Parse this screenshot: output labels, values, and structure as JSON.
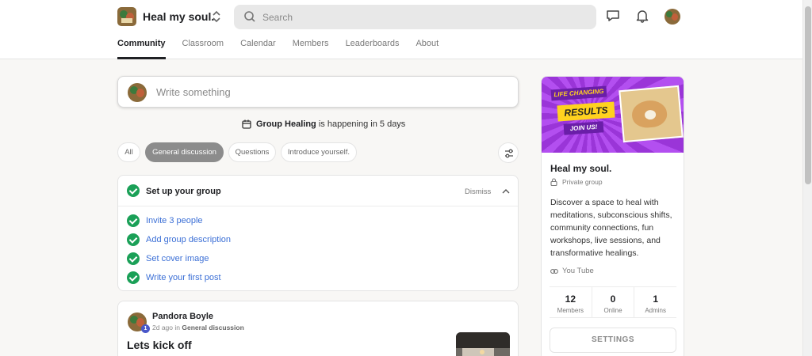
{
  "header": {
    "group_name": "Heal my soul.",
    "search_placeholder": "Search"
  },
  "tabs": [
    {
      "label": "Community",
      "active": true
    },
    {
      "label": "Classroom",
      "active": false
    },
    {
      "label": "Calendar",
      "active": false
    },
    {
      "label": "Members",
      "active": false
    },
    {
      "label": "Leaderboards",
      "active": false
    },
    {
      "label": "About",
      "active": false
    }
  ],
  "composer": {
    "placeholder": "Write something"
  },
  "event": {
    "name": "Group Healing",
    "suffix": "is happening in 5 days"
  },
  "filters": [
    "All",
    "General discussion",
    "Questions",
    "Introduce yourself."
  ],
  "setup": {
    "title": "Set up your group",
    "dismiss": "Dismiss",
    "tasks": [
      "Invite 3 people",
      "Add group description",
      "Set cover image",
      "Write your first post"
    ]
  },
  "post": {
    "author": "Pandora Boyle",
    "level": "1",
    "time": "2d ago in",
    "category": "General discussion",
    "title": "Lets kick off"
  },
  "sidebar": {
    "banner": {
      "line1": "LIFE CHANGING",
      "line2": "RESULTS",
      "line3": "JOIN US!"
    },
    "name": "Heal my soul.",
    "privacy": "Private group",
    "description": "Discover a space to heal with meditations, subconscious shifts, community connections, fun workshops, live sessions, and transformative healings.",
    "link": "You Tube",
    "stats": [
      {
        "value": "12",
        "label": "Members"
      },
      {
        "value": "0",
        "label": "Online"
      },
      {
        "value": "1",
        "label": "Admins"
      }
    ],
    "settings_label": "SETTINGS"
  },
  "colors": {
    "accent_green": "#1aa057",
    "link_blue": "#3b6fd6",
    "banner_purple": "#a43ce0",
    "banner_yellow": "#ffd21f"
  }
}
